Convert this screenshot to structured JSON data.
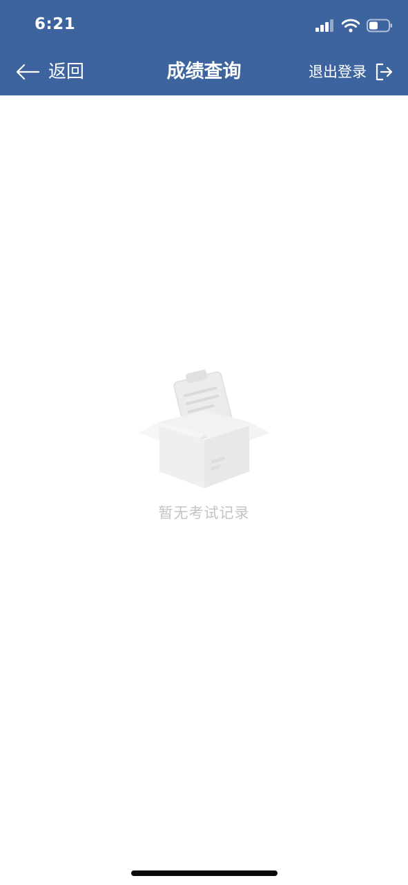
{
  "status_bar": {
    "time": "6:21",
    "icons": [
      "signal-icon",
      "wifi-icon",
      "battery-icon"
    ]
  },
  "nav": {
    "back_label": "返回",
    "title": "成绩查询",
    "logout_label": "退出登录"
  },
  "empty_state": {
    "message": "暂无考试记录",
    "illustration": "empty-box-icon"
  },
  "colors": {
    "header_bg": "#3e64a0",
    "header_text": "#ffffff",
    "empty_text": "#c3c3c3",
    "page_bg": "#ffffff"
  }
}
